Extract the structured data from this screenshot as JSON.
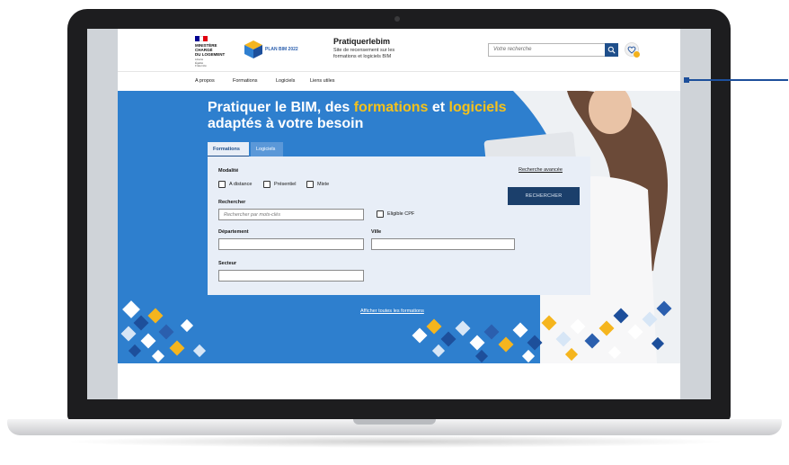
{
  "header": {
    "ministry_lines": "MINISTÈRE\nCHARGÉ\nDU LOGEMENT",
    "devise_lines": "Liberté\nÉgalité\nFraternité",
    "plan_bim_label": "PLAN BIM 2022",
    "brand_title": "Pratiquerlebim",
    "brand_subtitle": "Site de recensement sur les formations et logiciels BIM",
    "search_placeholder": "Votre recherche"
  },
  "nav": {
    "items": [
      "A propos",
      "Formations",
      "Logiciels",
      "Liens utiles"
    ]
  },
  "hero": {
    "title_part1": "Pratiquer le BIM, des ",
    "title_accent1": "formations",
    "title_part2": " et ",
    "title_accent2": "logiciels",
    "title_part3": " adaptés à votre besoin"
  },
  "tabs": {
    "formations": "Formations",
    "logiciels": "Logiciels"
  },
  "form": {
    "modalite_label": "Modalité",
    "options": [
      "A distance",
      "Présentiel",
      "Mixte"
    ],
    "rechercher_label": "Rechercher",
    "rechercher_placeholder": "Rechercher par mots-clés",
    "eligible_label": "Eligible CPF",
    "departement_label": "Département",
    "ville_label": "Ville",
    "secteur_label": "Secteur",
    "advanced_link": "Recherche avancée",
    "submit_label": "RECHERCHER"
  },
  "links": {
    "show_all": "Afficher toutes les formations"
  },
  "colors": {
    "hero_blue": "#2e7fce",
    "accent_yellow": "#f5c21b",
    "button_navy": "#1b3f6b",
    "panel_bg": "#e8eef7"
  },
  "icons": [
    "search-icon",
    "heart-icon",
    "camera-icon",
    "plan-bim-cube-icon"
  ]
}
